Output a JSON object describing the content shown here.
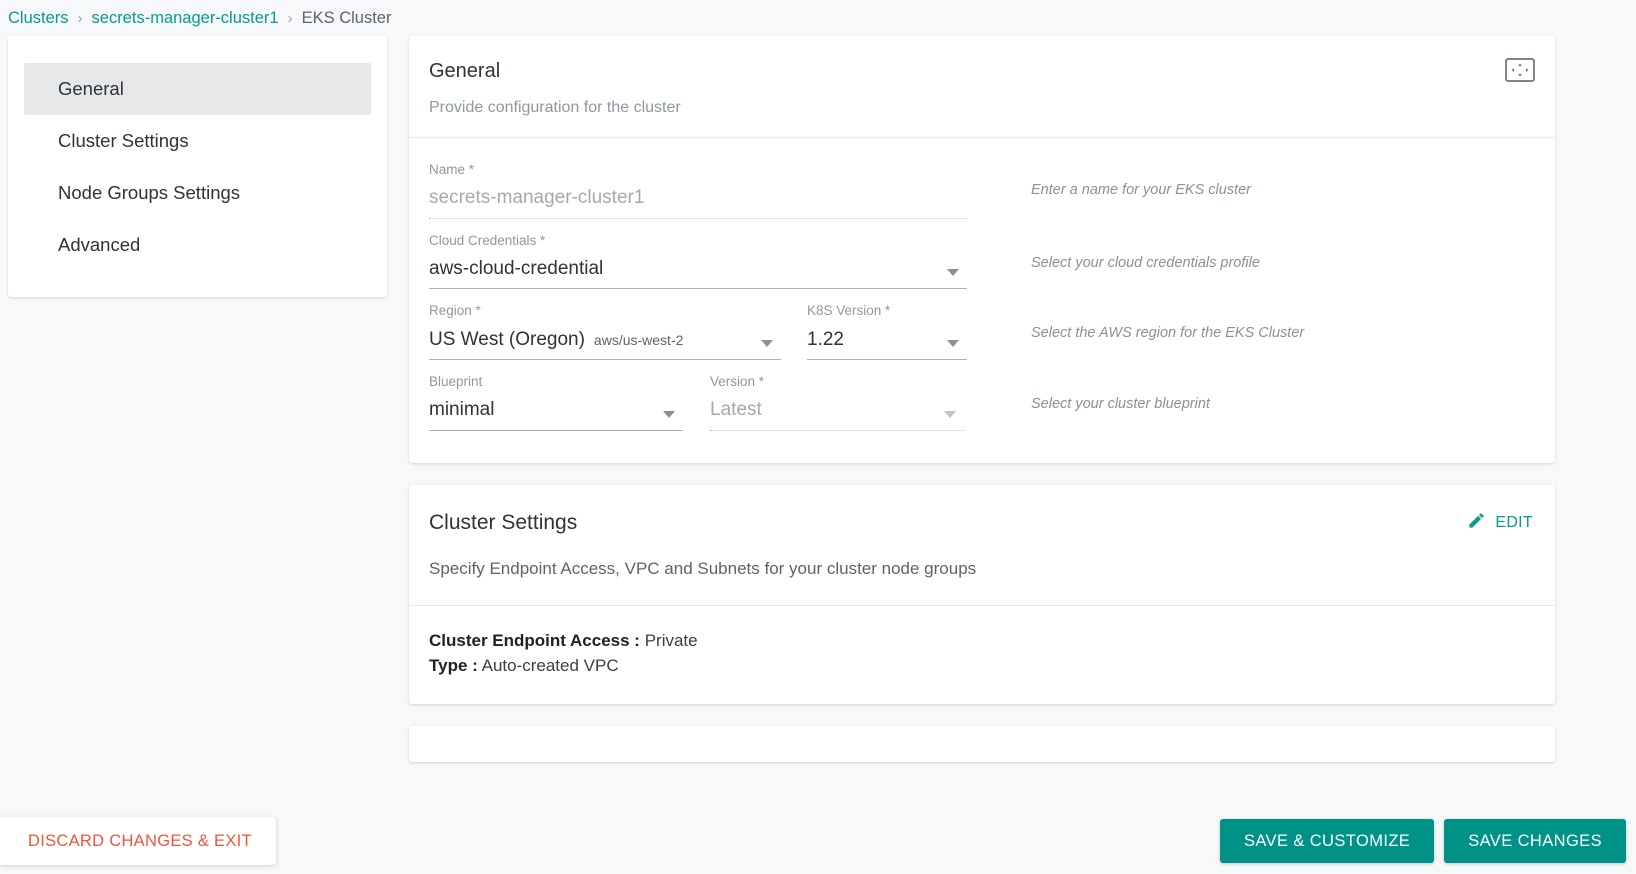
{
  "breadcrumb": {
    "items": [
      {
        "label": "Clusters",
        "current": false
      },
      {
        "label": "secrets-manager-cluster1",
        "current": false
      },
      {
        "label": "EKS Cluster",
        "current": true
      }
    ],
    "separator": "›"
  },
  "sidebar": {
    "items": [
      {
        "label": "General",
        "active": true
      },
      {
        "label": "Cluster Settings",
        "active": false
      },
      {
        "label": "Node Groups Settings",
        "active": false
      },
      {
        "label": "Advanced",
        "active": false
      }
    ]
  },
  "general_card": {
    "title": "General",
    "subtitle": "Provide configuration for the cluster",
    "expand_icon": "expand-arrows-icon",
    "fields": {
      "name": {
        "label": "Name *",
        "value": "secrets-manager-cluster1",
        "hint": "Enter a name for your EKS cluster",
        "disabled": true
      },
      "cloud_credentials": {
        "label": "Cloud Credentials *",
        "value": "aws-cloud-credential",
        "hint": "Select your cloud credentials profile",
        "disabled": false
      },
      "region": {
        "label": "Region *",
        "value": "US West (Oregon)",
        "sub_value": "aws/us-west-2",
        "hint": "Select the AWS region for the EKS Cluster",
        "disabled": false
      },
      "k8s_version": {
        "label": "K8S Version *",
        "value": "1.22",
        "disabled": false
      },
      "blueprint": {
        "label": "Blueprint",
        "value": "minimal",
        "hint": "Select your cluster blueprint",
        "disabled": false
      },
      "version": {
        "label": "Version *",
        "value": "Latest",
        "disabled": true
      }
    }
  },
  "cluster_settings_card": {
    "title": "Cluster Settings",
    "subtitle": "Specify Endpoint Access, VPC and Subnets for your cluster node groups",
    "edit_label": "EDIT",
    "edit_icon": "pencil-icon",
    "details": [
      {
        "key": "Cluster Endpoint Access :",
        "value": "Private"
      },
      {
        "key": "Type :",
        "value": "Auto-created VPC"
      }
    ]
  },
  "bottom_bar": {
    "discard_label": "DISCARD CHANGES & EXIT",
    "save_customize_label": "SAVE & CUSTOMIZE",
    "save_changes_label": "SAVE CHANGES"
  },
  "colors": {
    "accent": "#009287",
    "link": "#089a8a",
    "danger": "#f4513b"
  }
}
